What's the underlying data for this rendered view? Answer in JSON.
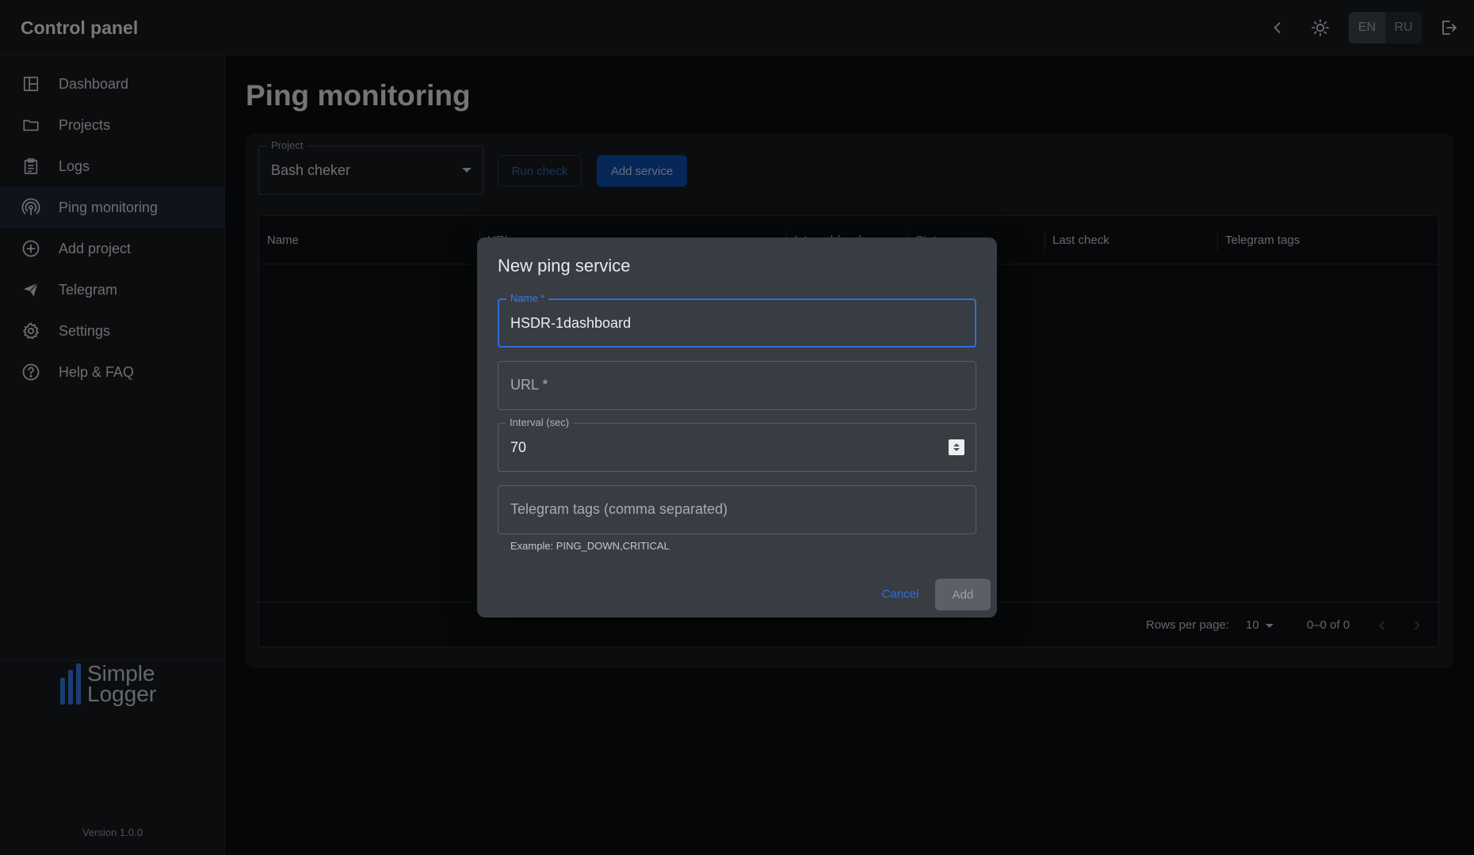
{
  "app": {
    "title": "Control panel"
  },
  "topbar": {
    "lang": {
      "en": "EN",
      "ru": "RU",
      "selected": "EN"
    },
    "icons": [
      "chevron-left-icon",
      "sun-icon",
      "logout-icon"
    ]
  },
  "sidebar": {
    "items": [
      {
        "label": "Dashboard",
        "icon": "dashboard-icon"
      },
      {
        "label": "Projects",
        "icon": "folder-icon"
      },
      {
        "label": "Logs",
        "icon": "clipboard-icon"
      },
      {
        "label": "Ping monitoring",
        "icon": "radar-icon",
        "active": true
      },
      {
        "label": "Add project",
        "icon": "plus-circle-icon"
      },
      {
        "label": "Telegram",
        "icon": "send-icon"
      },
      {
        "label": "Settings",
        "icon": "gear-icon"
      },
      {
        "label": "Help & FAQ",
        "icon": "help-circle-icon"
      }
    ],
    "logo": {
      "line1": "Simple",
      "line2": "Logger"
    },
    "version": "Version 1.0.0"
  },
  "main": {
    "title": "Ping monitoring",
    "project": {
      "label": "Project",
      "value": "Bash cheker"
    },
    "run_check": "Run check",
    "add_service": "Add service",
    "table": {
      "columns": [
        "Name",
        "URL",
        "Interval (sec)",
        "Status",
        "Last check",
        "Telegram tags"
      ],
      "rows": [],
      "rows_per_page_label": "Rows per page:",
      "rows_per_page": "10",
      "range": "0–0 of 0"
    }
  },
  "dialog": {
    "title": "New ping service",
    "name_label": "Name *",
    "name_value": "HSDR-1dashboard",
    "url_placeholder": "URL *",
    "interval_label": "Interval (sec)",
    "interval_value": "70",
    "tags_placeholder": "Telegram tags (comma separated)",
    "tags_helper": "Example: PING_DOWN,CRITICAL",
    "cancel": "Cancel",
    "add": "Add"
  },
  "colors": {
    "accent": "#2f6fd6",
    "primary_button": "#0d47a1",
    "background": "#0a0c0f",
    "surface": "#16191d",
    "dialog": "#383c43"
  }
}
